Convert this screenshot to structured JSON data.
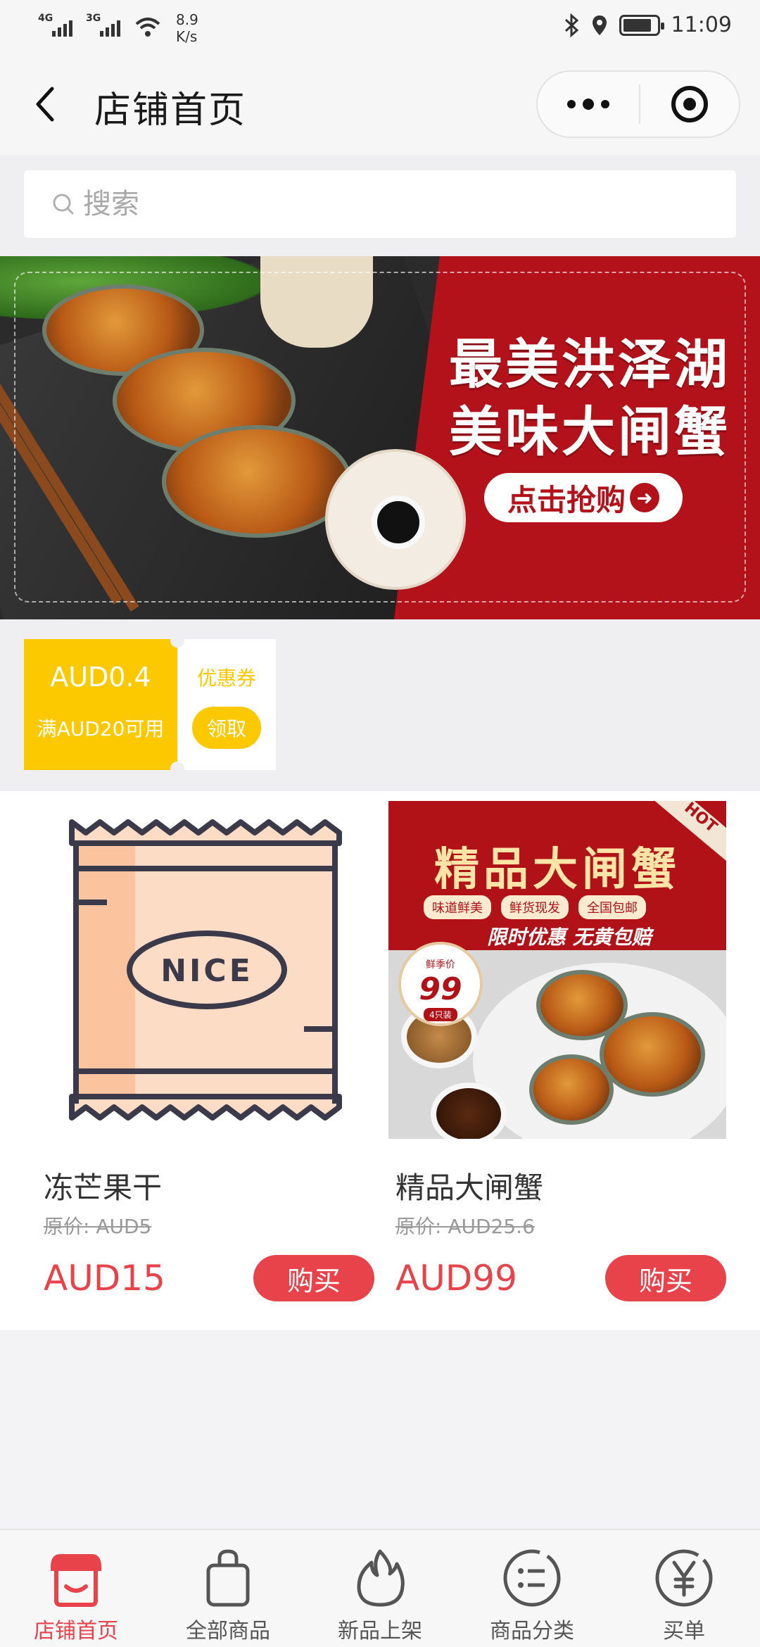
{
  "status_bar": {
    "signal1_label": "4G",
    "signal2_label": "3G",
    "net_speed_value": "8.9",
    "net_speed_unit": "K/s",
    "time": "11:09",
    "battery_level": 0.85
  },
  "nav": {
    "title": "店铺首页"
  },
  "search": {
    "placeholder": "搜索"
  },
  "banner": {
    "line1": "最美洪泽湖",
    "line2": "美味大闸蟹",
    "cta": "点击抢购"
  },
  "coupon": {
    "amount": "AUD0.4",
    "condition": "满AUD20可用",
    "label": "优惠券",
    "claim": "领取"
  },
  "products": [
    {
      "name": "冻芒果干",
      "original_price": "原价: AUD5",
      "price": "AUD15",
      "buy": "购买",
      "image_text": "NICE"
    },
    {
      "name": "精品大闸蟹",
      "original_price": "原价: AUD25.6",
      "price": "AUD99",
      "buy": "购买",
      "image_title": "精品大闸蟹",
      "image_tags": [
        "味道鲜美",
        "鲜货现发",
        "全国包邮"
      ],
      "image_subtitle": "限时优惠 无黄包赔",
      "image_badge_top": "鲜季价",
      "image_badge_price": "99",
      "image_badge_bottom": "4只装",
      "image_hot": "HOT"
    }
  ],
  "tabbar": [
    {
      "label": "店铺首页",
      "icon": "shop-icon",
      "active": true
    },
    {
      "label": "全部商品",
      "icon": "bag-icon",
      "active": false
    },
    {
      "label": "新品上架",
      "icon": "flame-icon",
      "active": false
    },
    {
      "label": "商品分类",
      "icon": "category-icon",
      "active": false
    },
    {
      "label": "买单",
      "icon": "yen-icon",
      "active": false
    }
  ],
  "colors": {
    "accent": "#e8424a",
    "coupon": "#fcc800",
    "banner_red": "#b3121a"
  }
}
